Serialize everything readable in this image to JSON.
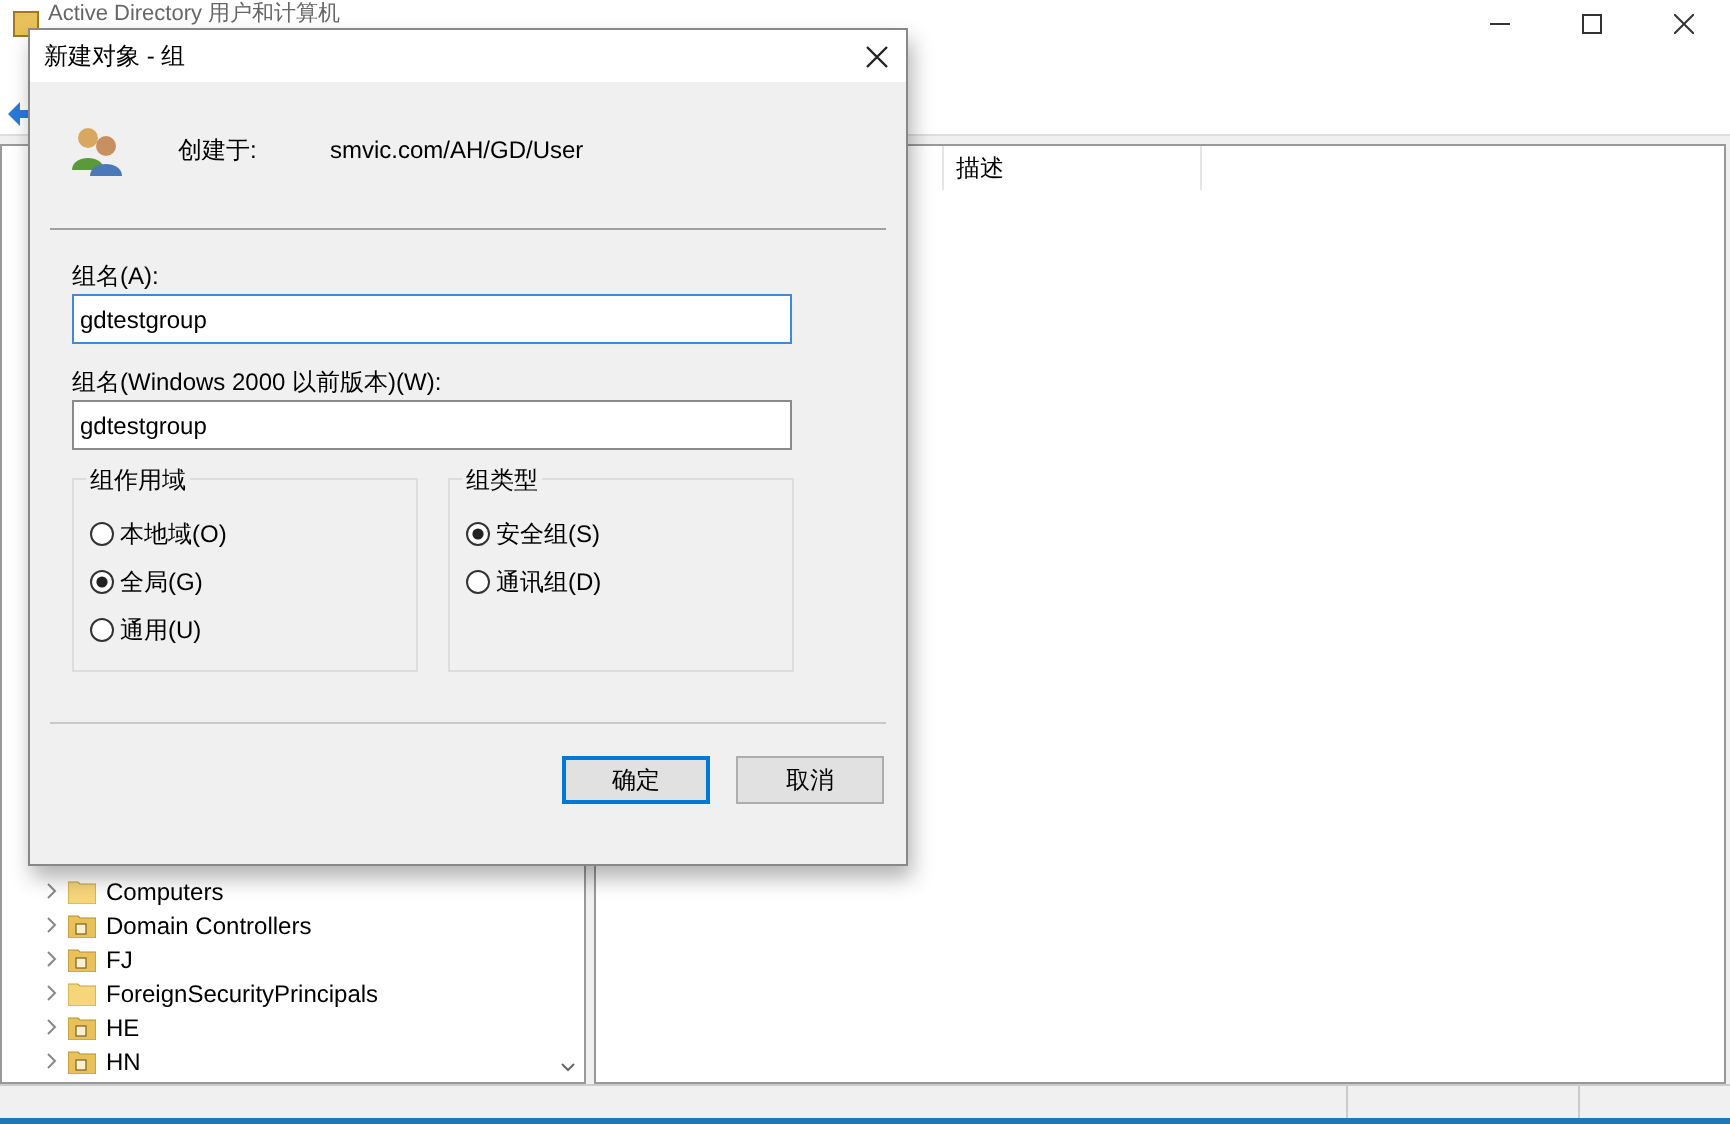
{
  "window": {
    "title": "Active Directory 用户和计算机"
  },
  "tree": {
    "items": [
      {
        "label": "Computers",
        "kind": "folder"
      },
      {
        "label": "Domain Controllers",
        "kind": "ou"
      },
      {
        "label": "FJ",
        "kind": "ou"
      },
      {
        "label": "ForeignSecurityPrincipals",
        "kind": "folder"
      },
      {
        "label": "HE",
        "kind": "ou"
      },
      {
        "label": "HN",
        "kind": "ou"
      }
    ]
  },
  "list": {
    "columns": [
      "描述"
    ]
  },
  "dialog": {
    "title": "新建对象 - 组",
    "created_in_label": "创建于:",
    "created_in_path": "smvic.com/AH/GD/User",
    "fields": [
      {
        "label": "组名(A):",
        "value": "gdtestgroup",
        "focused": true
      },
      {
        "label": "组名(Windows 2000 以前版本)(W):",
        "value": "gdtestgroup",
        "focused": false
      }
    ],
    "groups": [
      {
        "title": "组作用域",
        "options": [
          {
            "label": "本地域(O)",
            "selected": false
          },
          {
            "label": "全局(G)",
            "selected": true
          },
          {
            "label": "通用(U)",
            "selected": false
          }
        ]
      },
      {
        "title": "组类型",
        "options": [
          {
            "label": "安全组(S)",
            "selected": true
          },
          {
            "label": "通讯组(D)",
            "selected": false
          }
        ]
      }
    ],
    "buttons": [
      {
        "label": "确定",
        "default": true
      },
      {
        "label": "取消",
        "default": false
      }
    ]
  }
}
